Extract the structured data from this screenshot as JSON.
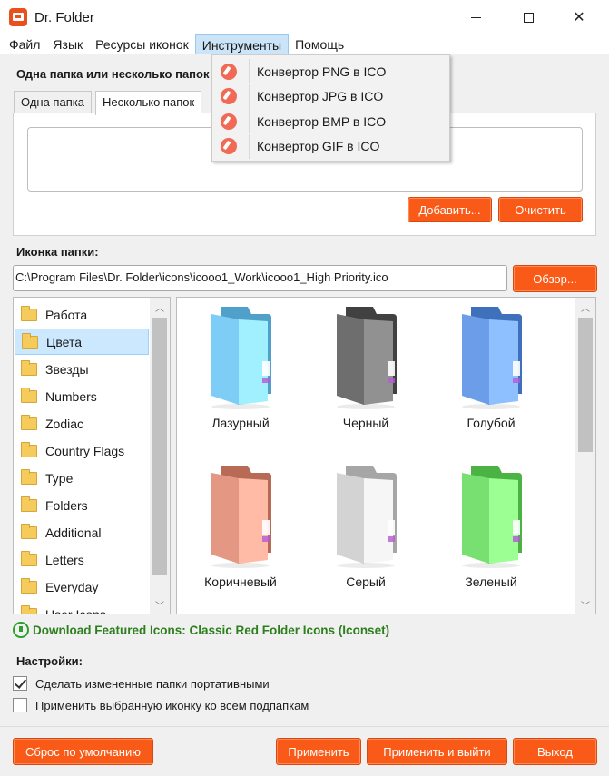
{
  "window": {
    "title": "Dr. Folder"
  },
  "menu": {
    "items": [
      "Файл",
      "Язык",
      "Ресурсы иконок",
      "Инструменты",
      "Помощь"
    ],
    "dropdown": [
      "Конвертор PNG в ICO",
      "Конвертор JPG в ICO",
      "Конвертор BMP в ICO",
      "Конвертор GIF в ICO"
    ]
  },
  "folders": {
    "section_title": "Одна папка или несколько папок",
    "tabs": [
      "Одна папка",
      "Несколько папок"
    ],
    "add_label": "Добавить...",
    "clear_label": "Очистить"
  },
  "icon": {
    "section_title": "Иконка папки:",
    "path": "C:\\Program Files\\Dr. Folder\\icons\\icooo1_Work\\icooo1_High Priority.ico",
    "browse_label": "Обзор..."
  },
  "categories": [
    "Работа",
    "Цвета",
    "Звезды",
    "Numbers",
    "Zodiac",
    "Country Flags",
    "Type",
    "Folders",
    "Additional",
    "Letters",
    "Everyday",
    "User Icons"
  ],
  "selected_category": "Цвета",
  "icons": [
    {
      "label": "Лазурный",
      "color": "#7ecdf6"
    },
    {
      "label": "Черный",
      "color": "#6e6e6e"
    },
    {
      "label": "Голубой",
      "color": "#6b9de8"
    },
    {
      "label": "Коричневый",
      "color": "#e49883"
    },
    {
      "label": "Серый",
      "color": "#d3d3d3"
    },
    {
      "label": "Зеленый",
      "color": "#78e070"
    }
  ],
  "download_link": "Download Featured Icons: Classic Red Folder Icons (Iconset)",
  "settings": {
    "title": "Настройки:",
    "portable_label": "Сделать измененные папки портативными",
    "portable_checked": true,
    "subfolders_label": "Применить выбранную иконку ко всем подпапкам",
    "subfolders_checked": false
  },
  "footer": {
    "reset_label": "Сброс по умолчанию",
    "apply_label": "Применить",
    "apply_exit_label": "Применить и выйти",
    "exit_label": "Выход"
  },
  "colors": {
    "accent": "#fa5a18",
    "link": "#2d7f1e",
    "selection": "#cce8ff"
  }
}
